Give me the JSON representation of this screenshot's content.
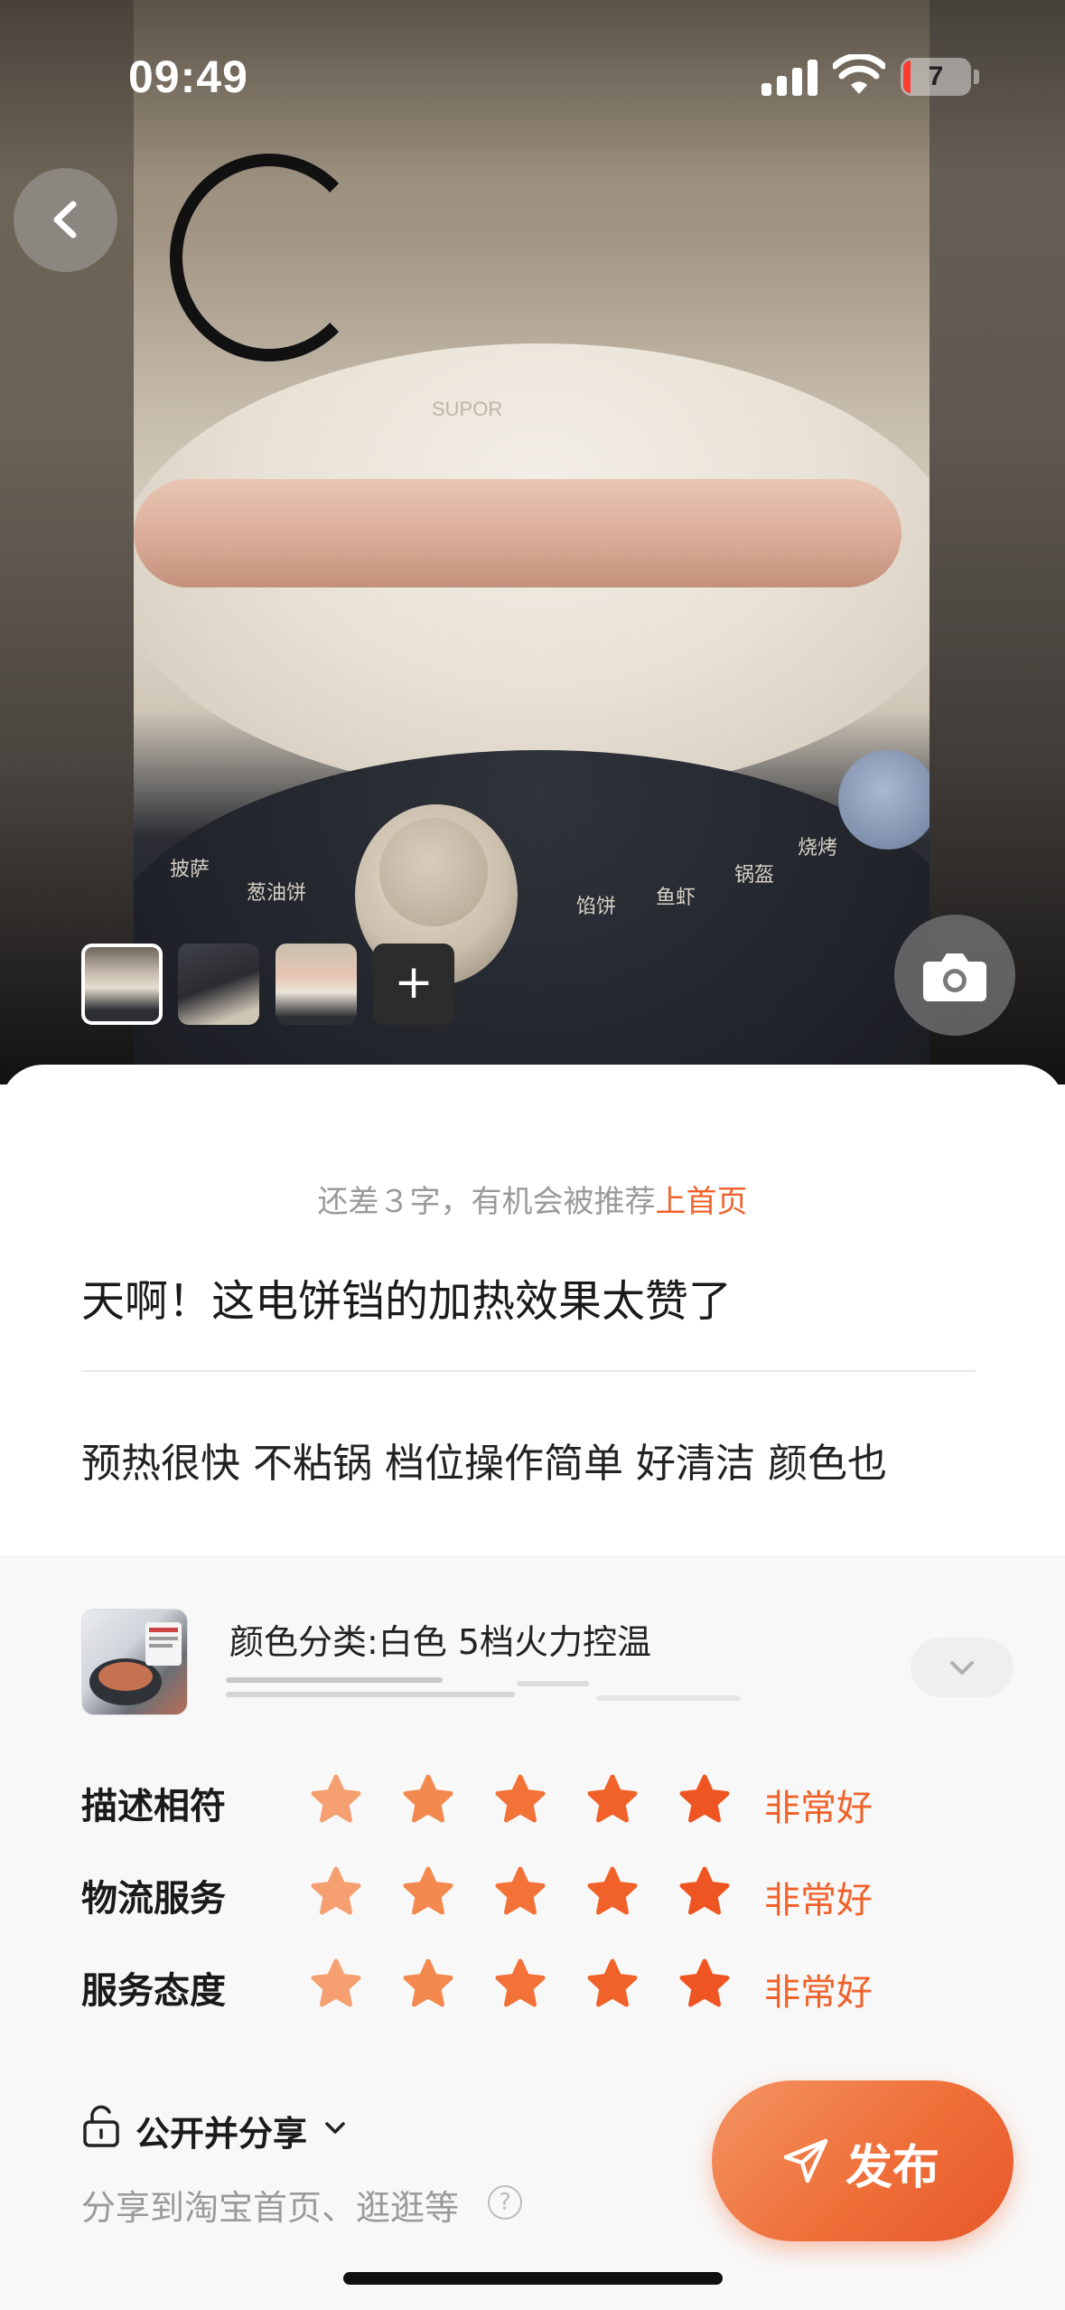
{
  "status_bar": {
    "time": "09:49",
    "battery": "7"
  },
  "photo": {
    "labels": [
      "SUPOR",
      "披萨",
      "葱油饼",
      "馅饼",
      "鱼虾",
      "锅盔",
      "烧烤"
    ],
    "add_label": "+"
  },
  "editor": {
    "hint_prefix": "还差３字，有机会被推荐",
    "hint_accent": "上首页",
    "title": "天啊！这电饼铛的加热效果太赞了",
    "body": "预热很快 不粘锅 档位操作简单 好清洁 颜色也"
  },
  "product": {
    "spec": "颜色分类:白色 5档火力控温"
  },
  "ratings": [
    {
      "label": "描述相符",
      "stars": 5,
      "text": "非常好"
    },
    {
      "label": "物流服务",
      "stars": 5,
      "text": "非常好"
    },
    {
      "label": "服务态度",
      "stars": 5,
      "text": "非常好"
    }
  ],
  "privacy": {
    "label": "公开并分享",
    "share_text": "分享到淘宝首页、逛逛等",
    "help": "?"
  },
  "publish": {
    "label": "发布"
  },
  "colors": {
    "accent": "#f0622a"
  }
}
